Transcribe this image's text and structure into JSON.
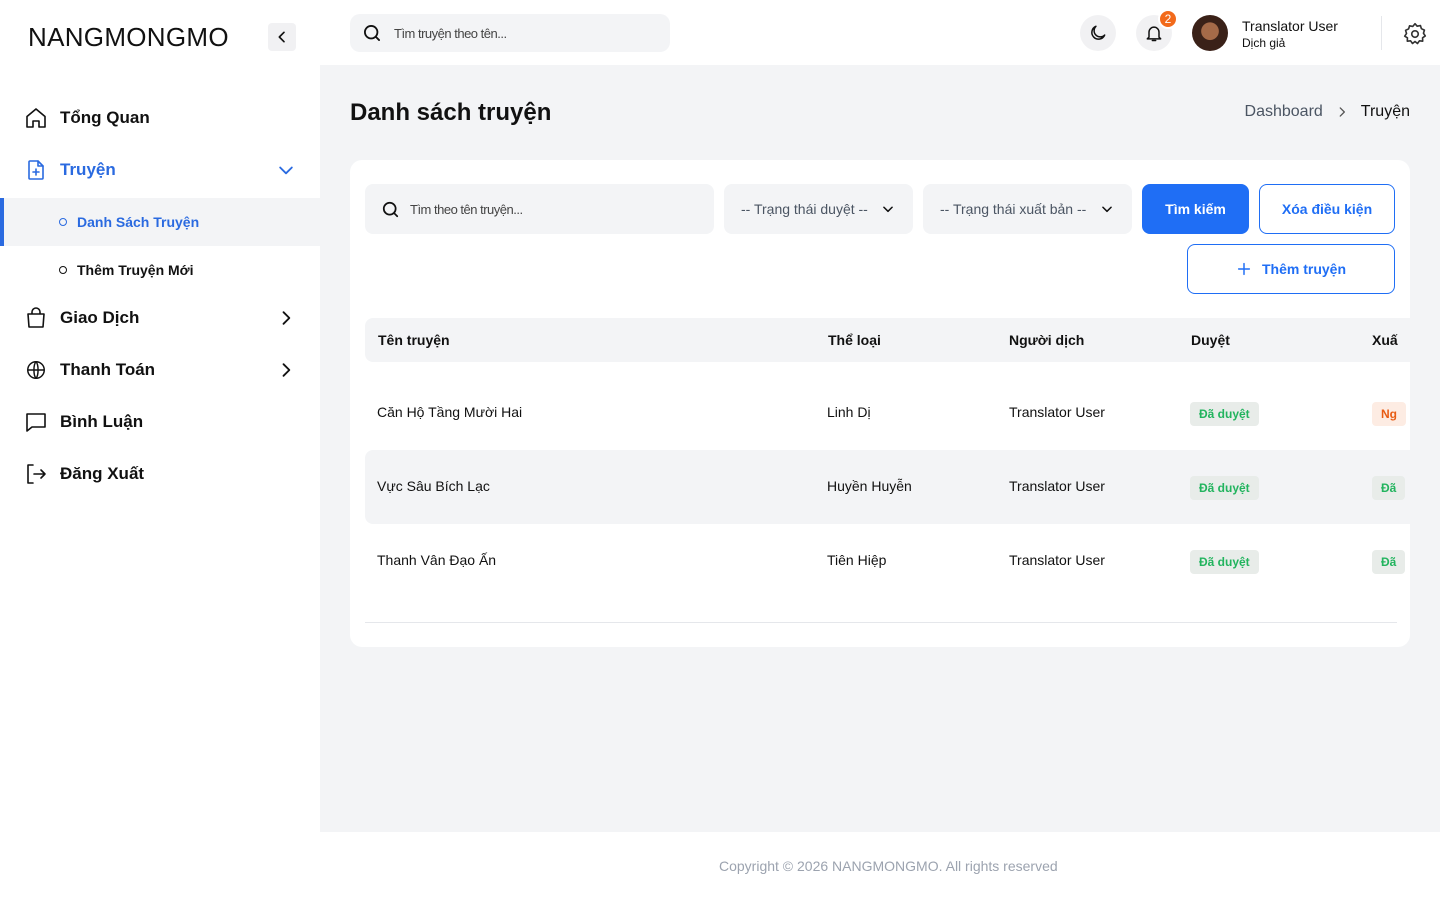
{
  "brand": "NANGMONGMO",
  "sidebar": {
    "items": [
      {
        "label": "Tổng Quan",
        "icon": "home-icon"
      },
      {
        "label": "Truyện",
        "icon": "file-plus-icon"
      },
      {
        "label": "Giao Dịch",
        "icon": "shopping-bag-icon"
      },
      {
        "label": "Thanh Toán",
        "icon": "globe-icon"
      },
      {
        "label": "Bình Luận",
        "icon": "message-square-icon"
      },
      {
        "label": "Đăng Xuất",
        "icon": "logout-icon"
      }
    ],
    "subitems": [
      {
        "label": "Danh Sách Truyện",
        "active": true
      },
      {
        "label": "Thêm Truyện Mới",
        "active": false
      }
    ]
  },
  "topbar": {
    "search_placeholder": "Tìm truyện theo tên...",
    "notification_count": "2",
    "user_name": "Translator User",
    "user_role": "Dịch giả"
  },
  "page": {
    "title": "Danh sách truyện",
    "breadcrumb": [
      "Dashboard",
      "Truyện"
    ]
  },
  "filters": {
    "search_placeholder": "Tìm theo tên truyện...",
    "approval_select": "-- Trạng thái duyệt --",
    "publish_select": "-- Trạng thái xuất bản --",
    "search_button": "Tìm kiếm",
    "clear_button": "Xóa điều kiện",
    "add_button": "Thêm truyện"
  },
  "table": {
    "columns": [
      "Tên truyện",
      "Thể loại",
      "Người dịch",
      "Duyệt",
      "Xuấ"
    ],
    "rows": [
      {
        "name": "Căn Hộ Tầng Mười Hai",
        "genre": "Linh Dị",
        "translator": "Translator User",
        "approval": "Đã duyệt",
        "publish": "Ng"
      },
      {
        "name": "Vực Sâu Bích Lạc",
        "genre": "Huyền Huyễn",
        "translator": "Translator User",
        "approval": "Đã duyệt",
        "publish": "Đã"
      },
      {
        "name": "Thanh Vân Đạo Ấn",
        "genre": "Tiên Hiệp",
        "translator": "Translator User",
        "approval": "Đã duyệt",
        "publish": "Đã"
      }
    ]
  },
  "footer": "Copyright © 2026 NANGMONGMO. All rights reserved",
  "colors": {
    "accent": "#1f6ef5",
    "approved": "#22b45e",
    "pending": "#e85c14",
    "badge": "#f26a1b"
  }
}
